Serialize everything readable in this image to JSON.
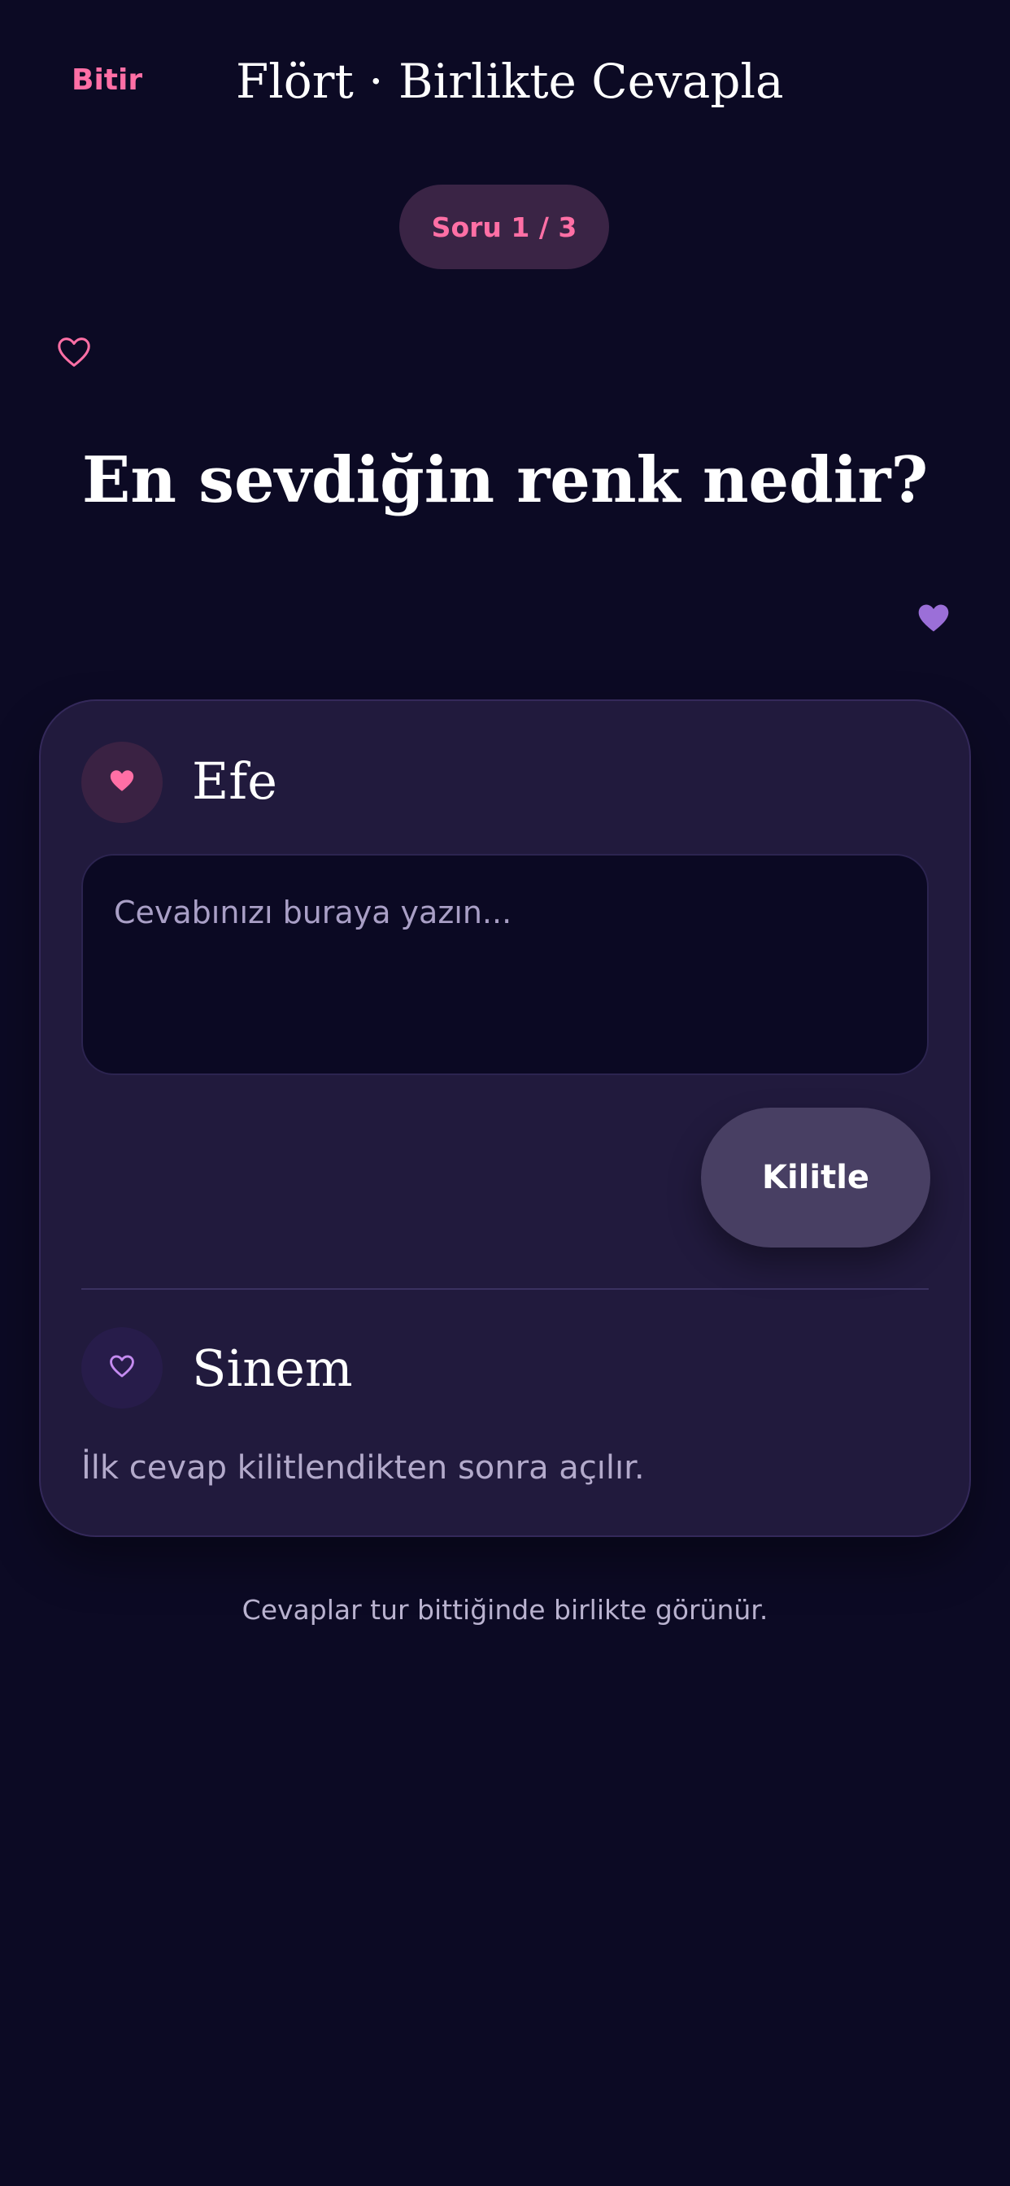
{
  "header": {
    "finish_label": "Bitir",
    "title": "Flört · Birlikte Cevapla"
  },
  "progress": {
    "label": "Soru 1 / 3",
    "current": 1,
    "total": 3
  },
  "question": {
    "text": "En sevdiğin renk nedir?"
  },
  "players": [
    {
      "name": "Efe",
      "icon": "heart-filled-icon",
      "answer_placeholder": "Cevabınızı buraya yazın...",
      "answer_value": "",
      "lock_label": "Kilitle"
    },
    {
      "name": "Sinem",
      "icon": "heart-outline-icon",
      "waiting_text": "İlk cevap kilitlendikten sonra açılır."
    }
  ],
  "footer": {
    "note": "Cevaplar tur bittiğinde birlikte görünür."
  },
  "colors": {
    "background": "#0c0a24",
    "card": "#211a3d",
    "accent_pink": "#ff6fa5",
    "accent_purple": "#9b6fd8",
    "lock_button": "#483f63"
  }
}
